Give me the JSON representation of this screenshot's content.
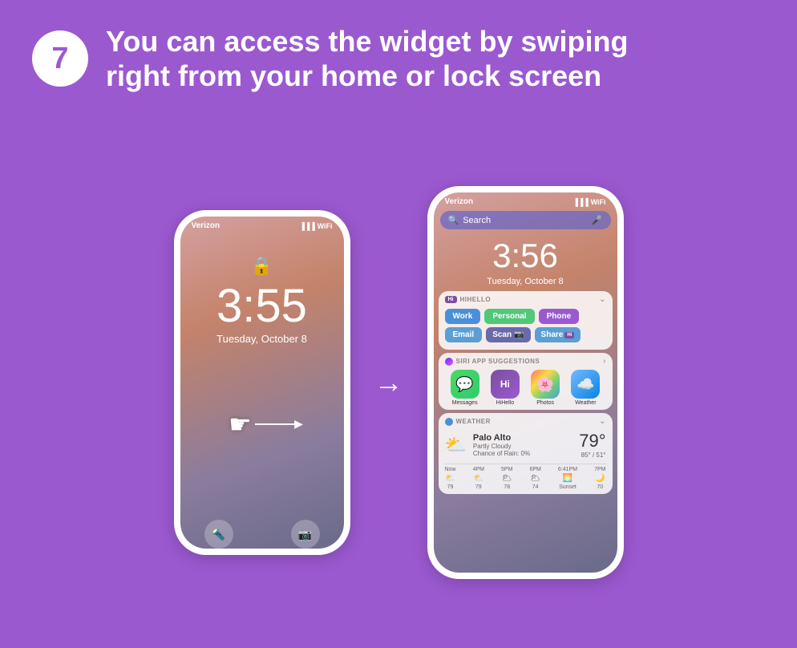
{
  "header": {
    "step_number": "7",
    "title_line1": "You can access the widget by swiping",
    "title_line2": "right from your home or lock screen"
  },
  "lock_screen": {
    "carrier": "Verizon",
    "time": "3:55",
    "date": "Tuesday, October 8",
    "lock_icon": "🔒"
  },
  "widget_screen": {
    "carrier": "Verizon",
    "time": "3:56",
    "date": "Tuesday, October 8",
    "search_placeholder": "Search",
    "hihello_widget": {
      "badge": "Hi",
      "title": "HIHELLO",
      "buttons": {
        "work": "Work",
        "personal": "Personal",
        "phone": "Phone",
        "email": "Email",
        "scan": "Scan",
        "share": "Share"
      }
    },
    "siri": {
      "title": "SIRI APP SUGGESTIONS",
      "apps": [
        {
          "name": "Messages",
          "icon": "messages"
        },
        {
          "name": "HiHello",
          "icon": "hihello"
        },
        {
          "name": "Photos",
          "icon": "photos"
        },
        {
          "name": "Weather",
          "icon": "weather"
        }
      ]
    },
    "weather": {
      "title": "WEATHER",
      "city": "Palo Alto",
      "description": "Partly Cloudy",
      "chance_of_rain": "Chance of Rain: 0%",
      "temperature": "79°",
      "high_low": "85° / 51°",
      "hourly": [
        {
          "time": "Now",
          "temp": "79"
        },
        {
          "time": "4PM",
          "temp": "79"
        },
        {
          "time": "5PM",
          "temp": "78"
        },
        {
          "time": "6PM",
          "temp": "74"
        },
        {
          "time": "6:41PM",
          "temp": "Sunset"
        },
        {
          "time": "7PM",
          "temp": "70"
        }
      ]
    }
  },
  "arrow_label": "→"
}
